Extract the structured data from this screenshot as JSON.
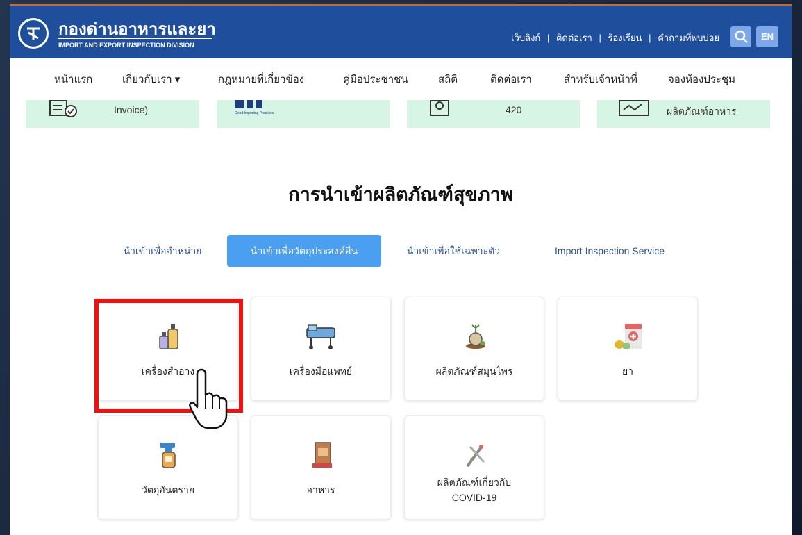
{
  "header": {
    "title_th": "กองด่านอาหารและยา",
    "title_en": "IMPORT AND EXPORT INSPECTION DIVISION",
    "links": [
      "เว็บลิงก์",
      "ติดต่อเรา",
      "ร้องเรียน",
      "คำถามที่พบบ่อย"
    ],
    "separator": "|",
    "lang": "EN"
  },
  "nav": [
    "หน้าแรก",
    "เกี่ยวกับเรา ▾",
    "กฎหมายที่เกี่ยวข้อง",
    "คู่มือประชาชน",
    "สถิติ",
    "ติดต่อเรา",
    "สำหรับเจ้าหน้าที่",
    "จองห้องประชุม"
  ],
  "top_cards": [
    "Invoice)",
    "",
    "420",
    "ผลิตภัณฑ์อาหาร"
  ],
  "section": {
    "title": "การนำเข้าผลิตภัณฑ์สุขภาพ",
    "tabs": [
      "นำเข้าเพื่อจำหน่าย",
      "นำเข้าเพื่อวัตถุประสงค์อื่น",
      "นำเข้าเพื่อใช้เฉพาะตัว",
      "Import Inspection Service"
    ],
    "active_tab": 1
  },
  "cards": [
    {
      "label": "เครื่องสำอาง",
      "icon": "cosmetics-icon"
    },
    {
      "label": "เครื่องมือแพทย์",
      "icon": "medical-bed-icon"
    },
    {
      "label": "ผลิตภัณฑ์สมุนไพร",
      "icon": "herb-icon"
    },
    {
      "label": "ยา",
      "icon": "medicine-icon"
    },
    {
      "label": "วัตถุอันตราย",
      "icon": "spray-bottle-icon"
    },
    {
      "label": "อาหาร",
      "icon": "food-icon"
    },
    {
      "label": "ผลิตภัณฑ์เกี่ยวกับ",
      "label2": "COVID-19",
      "icon": "covid-test-icon"
    }
  ],
  "colors": {
    "header_bg": "#1f4e9c",
    "accent": "#4a9ff0",
    "highlight": "#ee1111",
    "card_green": "#d7f5e4"
  }
}
